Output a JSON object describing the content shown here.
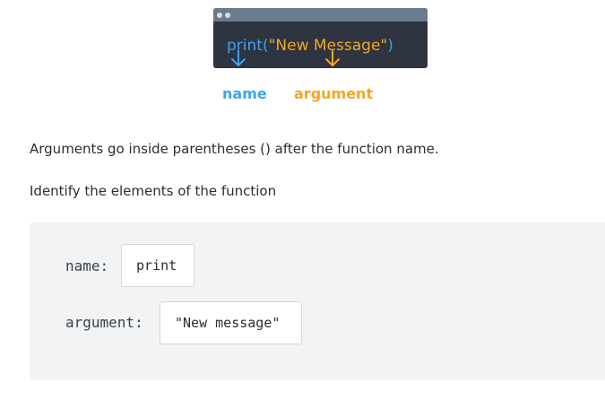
{
  "illustration": {
    "code_function": "print",
    "code_open": "(",
    "code_argument": "\"New Message\"",
    "code_close": ")",
    "label_name": "name",
    "label_argument": "argument",
    "colors": {
      "function": "#3ba4ee",
      "argument": "#f5a623",
      "window_bg": "#2e3440",
      "titlebar": "#6b7b8f"
    }
  },
  "lesson": {
    "explanation": "Arguments go inside parentheses () after the function name.",
    "instruction": "Identify the elements of the function"
  },
  "exercise": {
    "name_label": "name:",
    "name_value": "print",
    "argument_label": "argument:",
    "argument_value": "\"New message\""
  }
}
